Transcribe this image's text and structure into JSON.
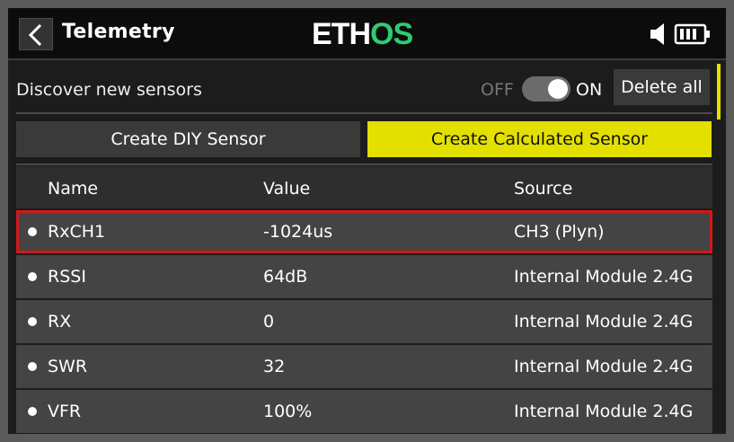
{
  "header": {
    "title": "Telemetry",
    "logo_main": "ETH",
    "logo_accent": "OS",
    "logo_accent_color": "#2ecc71",
    "icons": [
      "back-arrow-icon",
      "speaker-icon",
      "battery-icon"
    ]
  },
  "discover": {
    "label": "Discover new sensors",
    "off_label": "OFF",
    "on_label": "ON",
    "toggle_state": "on",
    "delete_all_label": "Delete all"
  },
  "buttons": {
    "create_diy": "Create DIY Sensor",
    "create_calculated": "Create Calculated Sensor",
    "accent_color": "#e3e000"
  },
  "table": {
    "columns": [
      "Name",
      "Value",
      "Source"
    ],
    "rows": [
      {
        "name": "RxCH1",
        "value": "-1024us",
        "source": "CH3 (Plyn)",
        "selected": true
      },
      {
        "name": "RSSI",
        "value": "64dB",
        "source": "Internal Module 2.4G",
        "selected": false
      },
      {
        "name": "RX",
        "value": "0",
        "source": "Internal Module 2.4G",
        "selected": false
      },
      {
        "name": "SWR",
        "value": "32",
        "source": "Internal Module 2.4G",
        "selected": false
      },
      {
        "name": "VFR",
        "value": "100%",
        "source": "Internal Module 2.4G",
        "selected": false
      }
    ],
    "selection_color": "#d01818"
  }
}
